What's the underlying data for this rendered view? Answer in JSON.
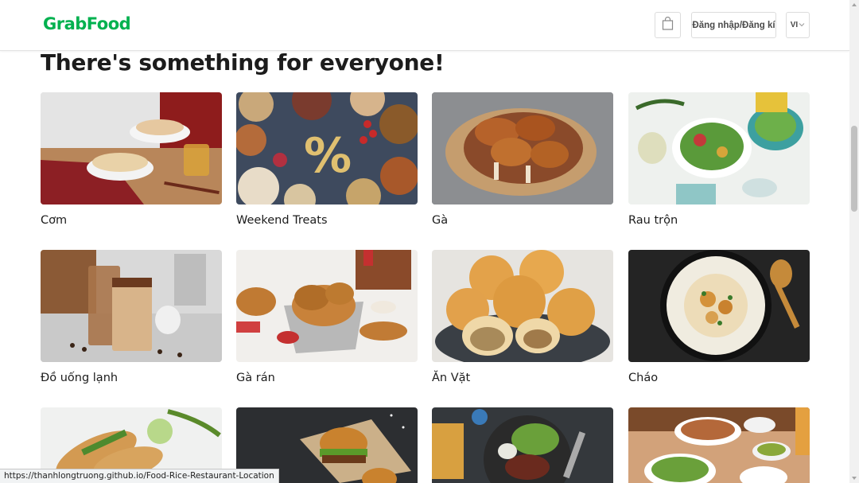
{
  "header": {
    "logo": "GrabFood",
    "login_label": "Đăng nhập/Đăng kí",
    "lang_label": "VI"
  },
  "main": {
    "heading": "There's something for everyone!",
    "categories": [
      {
        "label": "Cơm",
        "image": "rice-bowls-photo"
      },
      {
        "label": "Weekend Treats",
        "image": "party-spread-photo"
      },
      {
        "label": "Gà",
        "image": "roast-chicken-photo"
      },
      {
        "label": "Rau trộn",
        "image": "salad-photo"
      },
      {
        "label": "Đồ uống lạnh",
        "image": "iced-coffee-photo"
      },
      {
        "label": "Gà rán",
        "image": "fried-chicken-photo"
      },
      {
        "label": "Ăn Vặt",
        "image": "dumplings-photo"
      },
      {
        "label": "Cháo",
        "image": "porridge-photo"
      },
      {
        "label": "",
        "image": "banh-mi-photo"
      },
      {
        "label": "",
        "image": "burger-photo"
      },
      {
        "label": "",
        "image": "steak-fries-photo"
      },
      {
        "label": "",
        "image": "noodle-bowls-photo"
      }
    ]
  },
  "status_bar": {
    "url": "https://thanhlongtruong.github.io/Food-Rice-Restaurant-Location"
  },
  "colors": {
    "brand": "#00b14f"
  }
}
